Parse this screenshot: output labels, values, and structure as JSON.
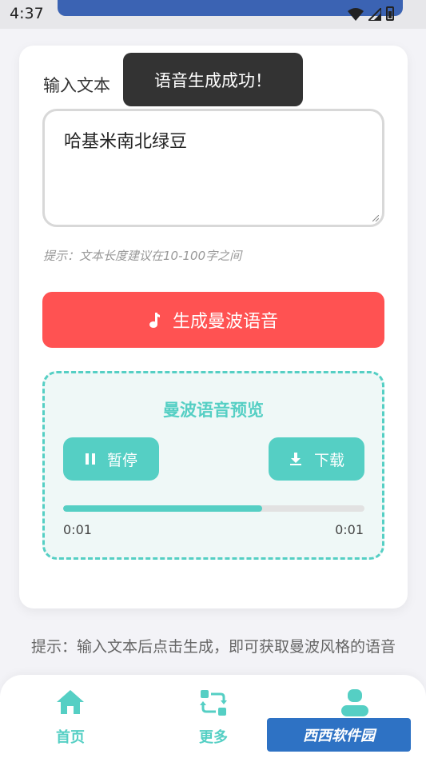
{
  "status_bar": {
    "time": "4:37"
  },
  "input": {
    "label": "输入文本",
    "value": "哈基米南北绿豆",
    "hint": "提示：文本长度建议在10-100字之间"
  },
  "generate_button": {
    "label": "生成曼波语音",
    "icon": "music-note-icon"
  },
  "preview": {
    "title": "曼波语音预览",
    "pause_label": "暂停",
    "download_label": "下载",
    "progress": 0.66,
    "current_time": "0:01",
    "total_time": "0:01"
  },
  "toast": {
    "message": "语音生成成功！"
  },
  "bottom_hint": "提示：输入文本后点击生成，即可获取曼波风格的语音",
  "tabs": [
    {
      "label": "首页",
      "icon": "home-icon"
    },
    {
      "label": "更多",
      "icon": "refresh-icon"
    },
    {
      "label": "",
      "icon": "user-icon"
    }
  ],
  "watermark": "西西软件园",
  "colors": {
    "accent": "#55cfc4",
    "primary_button": "#ff5252",
    "toast_bg": "#333333"
  }
}
